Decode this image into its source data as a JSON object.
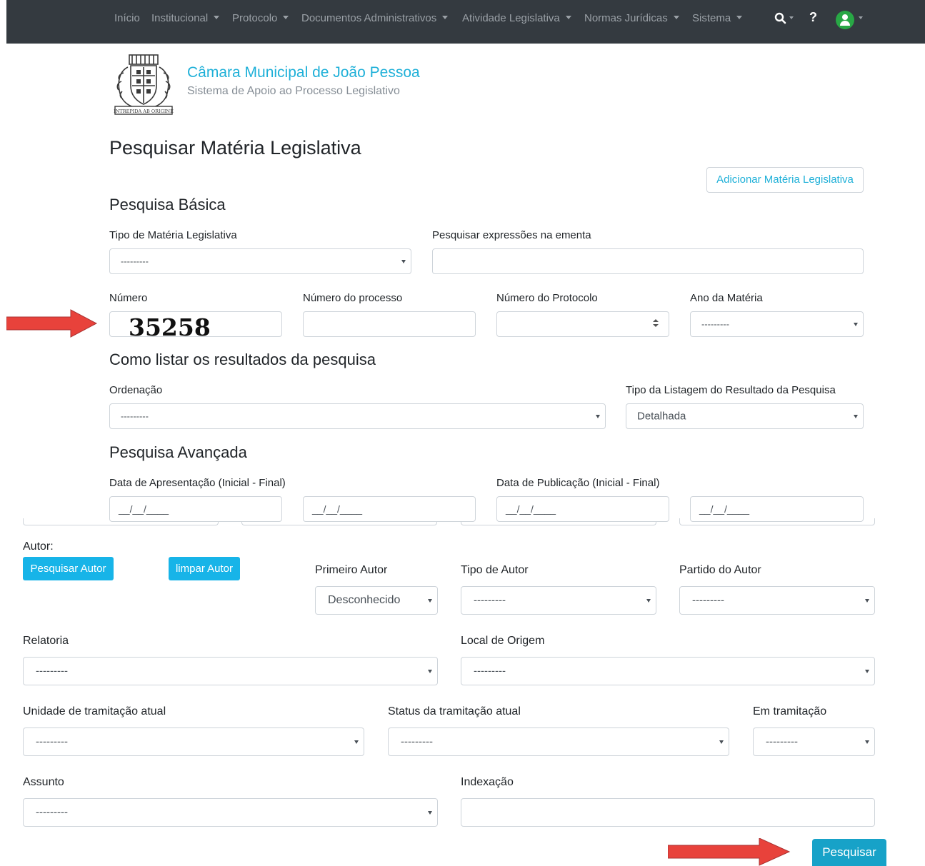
{
  "nav": {
    "inicio": "Início",
    "institucional": "Institucional",
    "protocolo": "Protocolo",
    "documentos": "Documentos Administrativos",
    "atividade": "Atividade Legislativa",
    "normas": "Normas Jurídicas",
    "sistema": "Sistema",
    "help": "?",
    "icons": [
      "search-icon",
      "help-icon",
      "user-avatar-icon"
    ]
  },
  "header": {
    "title": "Câmara Municipal de João Pessoa",
    "subtitle": "Sistema de Apoio ao Processo Legislativo",
    "logo_motto": "INTREPIDA AB ORIGINE"
  },
  "page": {
    "title": "Pesquisar Matéria Legislativa",
    "add_button": "Adicionar Matéria Legislativa"
  },
  "basic": {
    "heading": "Pesquisa Básica",
    "tipo_label": "Tipo de Matéria Legislativa",
    "tipo_value": "---------",
    "ementa_label": "Pesquisar expressões na ementa",
    "ementa_value": "",
    "numero_label": "Número",
    "numero_value": "35258",
    "processo_label": "Número do processo",
    "protocolo_label": "Número do Protocolo",
    "ano_label": "Ano da Matéria",
    "ano_value": "---------"
  },
  "listing": {
    "heading": "Como listar os resultados da pesquisa",
    "ordenacao_label": "Ordenação",
    "ordenacao_value": "---------",
    "tipo_listagem_label": "Tipo da Listagem do Resultado da Pesquisa",
    "tipo_listagem_value": "Detalhada"
  },
  "advanced": {
    "heading": "Pesquisa Avançada",
    "apresentacao_label": "Data de Apresentação (Inicial - Final)",
    "publicacao_label": "Data de Publicação (Inicial - Final)",
    "date_placeholder": "__/__/____",
    "autor_label": "Autor:",
    "pesquisar_autor": "Pesquisar Autor",
    "limpar_autor": "limpar Autor",
    "primeiro_autor_label": "Primeiro Autor",
    "primeiro_autor_value": "Desconhecido",
    "tipo_autor_label": "Tipo de Autor",
    "tipo_autor_value": "---------",
    "partido_label": "Partido do Autor",
    "partido_value": "---------",
    "relatoria_label": "Relatoria",
    "relatoria_value": "---------",
    "local_label": "Local de Origem",
    "local_value": "---------",
    "unidade_label": "Unidade de tramitação atual",
    "unidade_value": "---------",
    "status_label": "Status da tramitação atual",
    "status_value": "---------",
    "em_tramitacao_label": "Em tramitação",
    "em_tramitacao_value": "---------",
    "assunto_label": "Assunto",
    "assunto_value": "---------",
    "indexacao_label": "Indexação",
    "indexacao_value": "",
    "submit": "Pesquisar"
  },
  "colors": {
    "navbar": "#343a40",
    "brand": "#1fb0d8",
    "button_info": "#17b4e8",
    "arrow": "#e8423b"
  }
}
